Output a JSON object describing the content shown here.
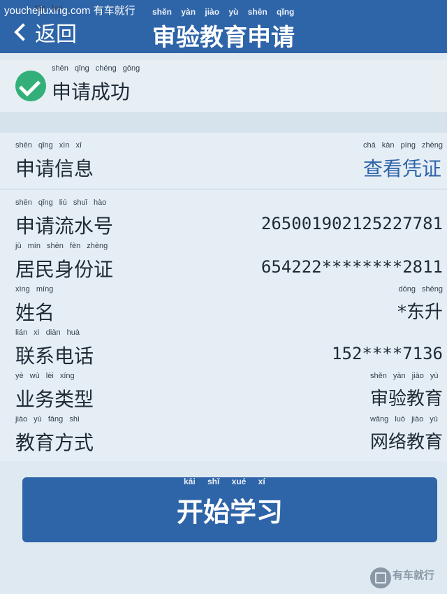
{
  "watermark_top": "youchejiuxing.com 有车就行",
  "header": {
    "back_label": "返回",
    "back_pinyin": "fǎn huí",
    "title": "审验教育申请",
    "title_pinyin": "shěn yàn jiào yù shēn qǐng"
  },
  "success": {
    "text": "申请成功",
    "pinyin": "shēn qǐng chéng gōng"
  },
  "info": {
    "label": "申请信息",
    "label_pinyin": "shēn qǐng xìn xī",
    "link": "查看凭证",
    "link_pinyin": "chá kàn píng zhèng"
  },
  "rows": [
    {
      "label": "申请流水号",
      "pinyin": "shēn qǐng liú shuǐ hào",
      "value": "26500190212522778​1",
      "value_pinyin": ""
    },
    {
      "label": "居民身份证",
      "pinyin": "jū mín shēn fèn zhèng",
      "value": "654222********2811",
      "value_pinyin": ""
    },
    {
      "label": "姓名",
      "pinyin": "xìng míng",
      "value": "*东升",
      "value_pinyin": "dōng shēng"
    },
    {
      "label": "联系电话",
      "pinyin": "lián xì diàn huà",
      "value": "152****7136",
      "value_pinyin": ""
    },
    {
      "label": "业务类型",
      "pinyin": "yè wù lèi xíng",
      "value": "审验教育",
      "value_pinyin": "shěn yàn jiào yù"
    },
    {
      "label": "教育方式",
      "pinyin": "jiào yù fāng shì",
      "value": "网络教育",
      "value_pinyin": "wǎng luò jiào yù"
    }
  ],
  "button": {
    "label": "开始学习",
    "pinyin": "kāi shǐ xué xí"
  },
  "watermark_bottom": "有车就行",
  "colors": {
    "primary": "#2e64a8",
    "success": "#33b07a",
    "background": "#dfe9f1"
  }
}
